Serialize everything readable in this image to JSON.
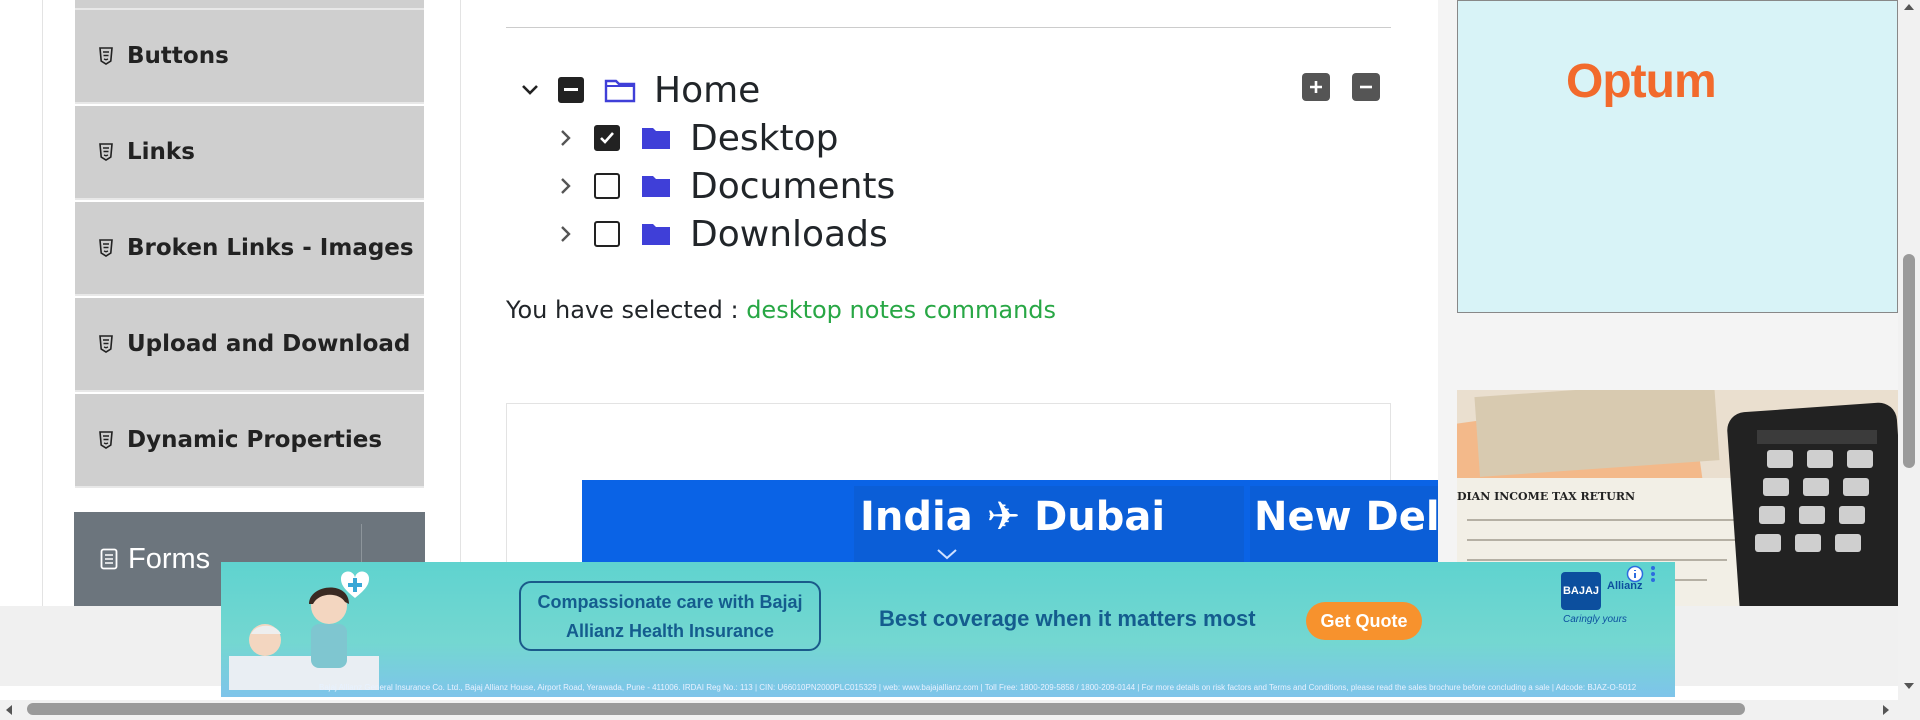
{
  "sidebar": {
    "items": [
      {
        "label": "Buttons",
        "icon": "html5-icon"
      },
      {
        "label": "Links",
        "icon": "html5-icon"
      },
      {
        "label": "Broken Links - Images",
        "icon": "html5-icon"
      },
      {
        "label": "Upload and Download",
        "icon": "html5-icon"
      },
      {
        "label": "Dynamic Properties",
        "icon": "html5-icon"
      }
    ],
    "group_forms": {
      "label": "Forms",
      "icon": "document-icon"
    }
  },
  "tree": {
    "root": {
      "label": "Home",
      "state": "indeterminate",
      "expanded": true
    },
    "children": [
      {
        "label": "Desktop",
        "checked": true
      },
      {
        "label": "Documents",
        "checked": false
      },
      {
        "label": "Downloads",
        "checked": false
      }
    ],
    "expand_all_label": "+",
    "collapse_all_label": "−"
  },
  "result": {
    "prefix": "You have selected :",
    "items": "desktop notes commands"
  },
  "flight_ad": {
    "route_1": "India ✈ Dubai",
    "route_2": "New Delh"
  },
  "right_ads": {
    "optum_logo": "Optum",
    "tax_caption": "DIAN INCOME TAX RETURN"
  },
  "bottom_ad": {
    "tagline": "Compassionate care with Bajaj Allianz Health Insurance",
    "headline": "Best coverage when it matters most",
    "cta": "Get Quote",
    "brand": "BAJAJ",
    "brand_text": "Allianz",
    "slogan": "Caringly yours",
    "fine_print": "Bajaj Allianz General Insurance Co. Ltd., Bajaj Allianz House, Airport Road, Yerawada, Pune - 411006. IRDAI Reg No.: 113 | CIN: U66010PN2000PLC015329 | web: www.bajajallianz.com | Toll Free: 1800-209-5858 / 1800-209-0144 | For more details on risk factors and Terms and Conditions, please read the sales brochure before concluding a sale | Adcode: BJAZ-O-5012"
  },
  "colors": {
    "sidebar_item_bg": "#cfcfcf",
    "group_bg": "#6c757d",
    "result_green": "#28a745",
    "folder_blue": "#3f3fd8",
    "optum_orange": "#f26a2c",
    "cta_orange": "#f7922d"
  }
}
